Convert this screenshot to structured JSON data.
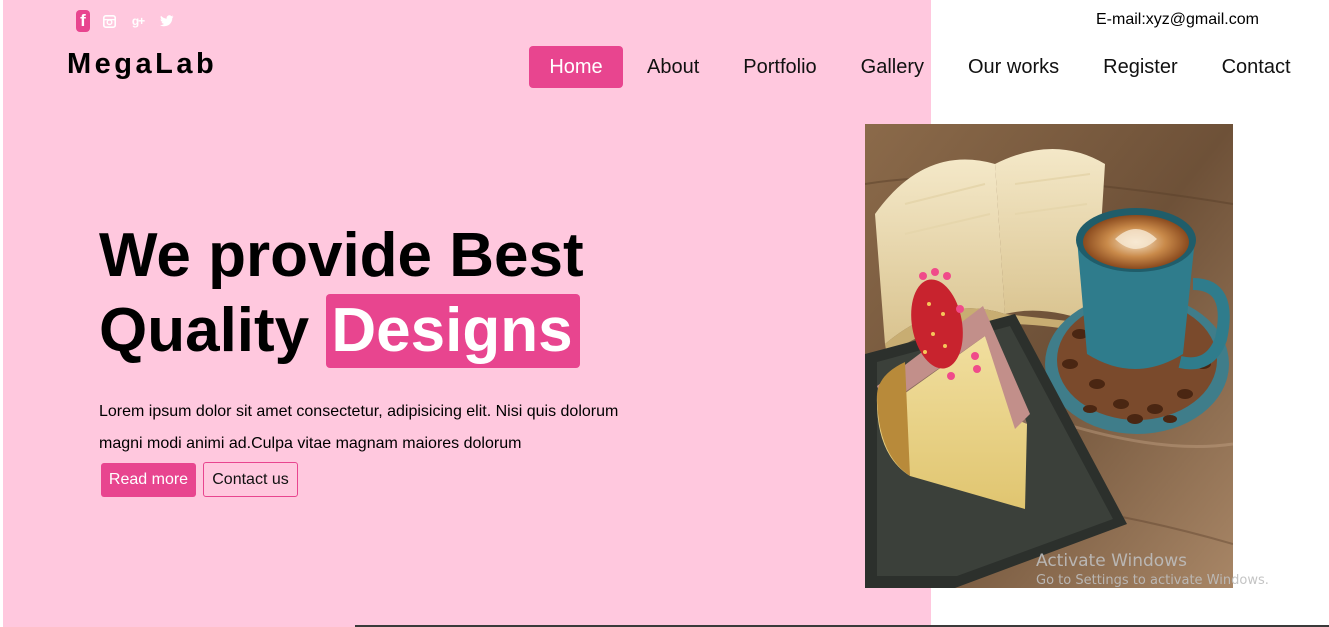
{
  "colors": {
    "accent": "#e8458f",
    "hero_background": "#ffc8de",
    "page_background": "#ffffff"
  },
  "topbar": {
    "social_icons": [
      "facebook-icon",
      "instagram-icon",
      "google-plus-icon",
      "twitter-icon"
    ],
    "facebook_glyph": "f",
    "google_plus_glyph": "g+",
    "email": "E-mail:xyz@gmail.com"
  },
  "brand": {
    "name": "MegaLab"
  },
  "nav": {
    "items": [
      {
        "label": "Home",
        "active": true
      },
      {
        "label": "About"
      },
      {
        "label": "Portfolio"
      },
      {
        "label": "Gallery"
      },
      {
        "label": "Our works"
      },
      {
        "label": "Register"
      },
      {
        "label": "Contact"
      }
    ]
  },
  "hero": {
    "title_line1": "We provide Best",
    "title_line2_prefix": "Quality",
    "title_highlight": "Designs",
    "text": "Lorem ipsum dolor sit amet consectetur, adipisicing elit. Nisi quis dolorum magni modi animi ad.Culpa vitae magnam maiores dolorum",
    "read_more_label": "Read more",
    "contact_label": "Contact us"
  },
  "watermark": {
    "title": "Activate Windows",
    "subtitle": "Go to Settings to activate Windows."
  }
}
